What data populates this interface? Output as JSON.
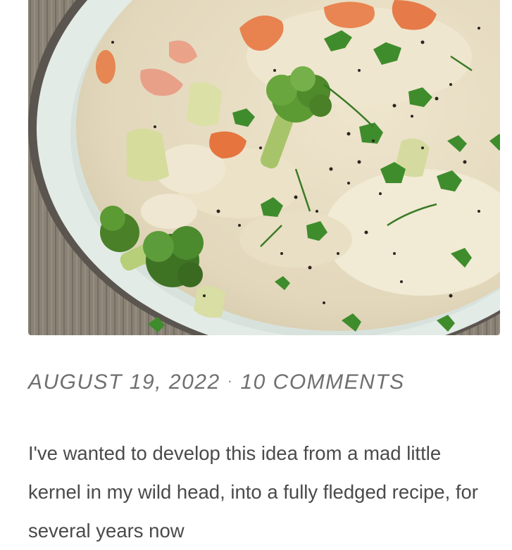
{
  "post": {
    "image_alt": "creamy fish and vegetable chowder with broccoli, carrots and parsley",
    "date": "AUGUST 19, 2022",
    "separator": "·",
    "comments": "10 COMMENTS",
    "excerpt": "I've wanted to develop this idea from a mad little kernel in my wild head, into a fully fledged recipe, for several years now"
  },
  "colors": {
    "meta_text": "#6f6f6f",
    "body_text": "#4a4a4a",
    "soup": "#e6dcc2",
    "broccoli": "#4f8a2b",
    "carrot": "#e57a4a",
    "bowl_rim": "#dfe7e3"
  }
}
